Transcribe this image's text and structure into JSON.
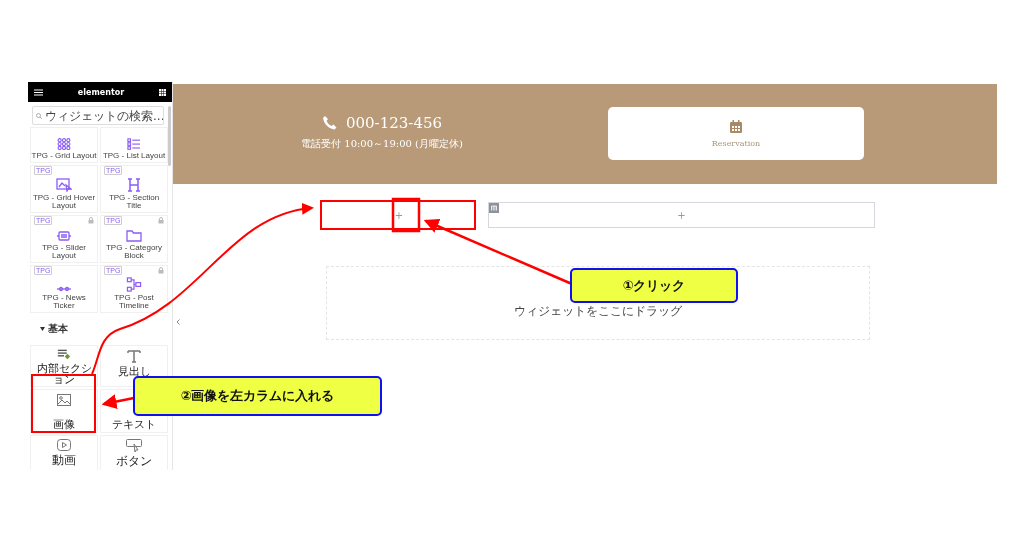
{
  "sidebar": {
    "logo": "elementor",
    "search": {
      "placeholder": "ウィジェットの検索..."
    },
    "widgets": [
      {
        "label": "TPG - Grid Layout",
        "kind": "grid",
        "locked": false
      },
      {
        "label": "TPG - List Layout",
        "kind": "list",
        "locked": false
      },
      {
        "label": "TPG - Grid Hover Layout",
        "kind": "hover",
        "badge": "TPG",
        "locked": false
      },
      {
        "label": "TPG - Section Title",
        "kind": "heading",
        "badge": "TPG",
        "locked": false
      },
      {
        "label": "TPG - Slider Layout",
        "kind": "slider",
        "badge": "TPG",
        "locked": true
      },
      {
        "label": "TPG - Category Block",
        "kind": "folder",
        "badge": "TPG",
        "locked": true
      },
      {
        "label": "TPG - News Ticker",
        "kind": "ticker",
        "badge": "TPG",
        "locked": false
      },
      {
        "label": "TPG - Post Timeline",
        "kind": "timeline",
        "badge": "TPG",
        "locked": true
      }
    ],
    "section": {
      "label": "基本",
      "expanded": true
    },
    "basic_widgets": [
      {
        "label": "内部セクション",
        "kind": "inner"
      },
      {
        "label": "見出し",
        "kind": "title"
      },
      {
        "label": "画像",
        "kind": "image"
      },
      {
        "label": "テキスト",
        "kind": "text"
      },
      {
        "label": "動画",
        "kind": "video"
      },
      {
        "label": "ボタン",
        "kind": "button"
      }
    ]
  },
  "canvas": {
    "phone": "000-123-456",
    "hours": "電話受付 10:00～19:00 (月曜定休)",
    "reservation": "Reservation",
    "columns": [
      {
        "add": "+"
      },
      {
        "add": "+"
      }
    ],
    "drop_hint": "ウィジェットをここにドラッグ"
  },
  "callouts": [
    {
      "text": "①クリック"
    },
    {
      "text": "②画像を左カラムに入れる"
    }
  ]
}
